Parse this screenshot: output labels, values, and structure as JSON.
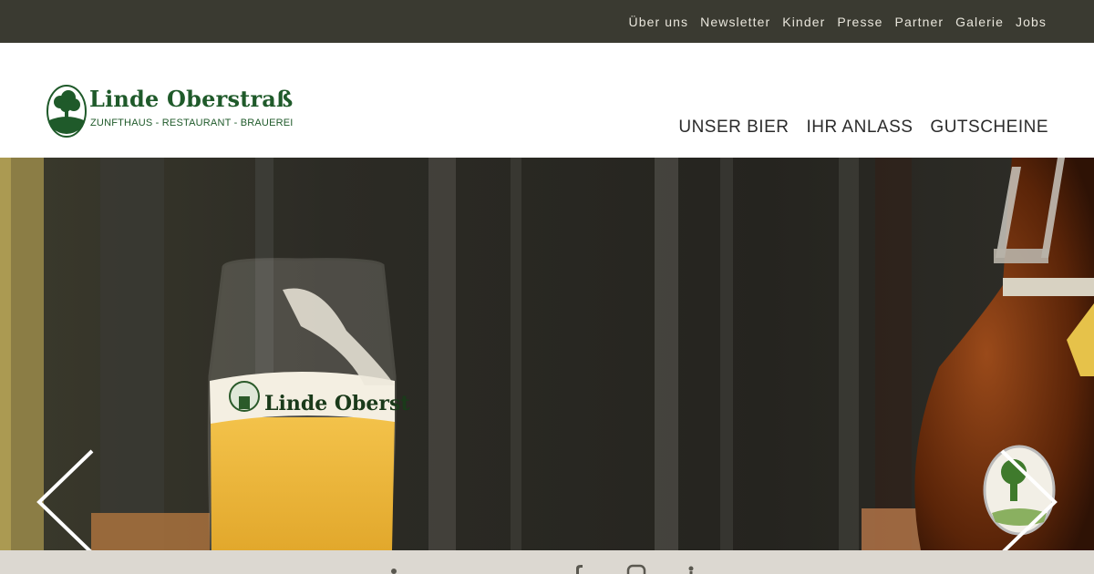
{
  "topnav": {
    "items": [
      "Über uns",
      "Newsletter",
      "Kinder",
      "Presse",
      "Partner",
      "Galerie",
      "Jobs"
    ]
  },
  "logo": {
    "title": "Linde Oberstraß",
    "subtitle": "ZUNFTHAUS - RESTAURANT - BRAUEREI",
    "glass_text": "Linde Oberst"
  },
  "mainnav": {
    "items": [
      "UNSER BIER",
      "IHR ANLASS",
      "GUTSCHEINE"
    ]
  },
  "colors": {
    "topbar": "#3a3a31",
    "brand_green": "#1f5a2a",
    "footer": "#dcd8d1"
  },
  "hero": {
    "prev_icon": "chevron-left-icon",
    "next_icon": "chevron-right-icon"
  },
  "social": {
    "icons": [
      "facebook-icon",
      "instagram-icon",
      "link-icon"
    ]
  }
}
